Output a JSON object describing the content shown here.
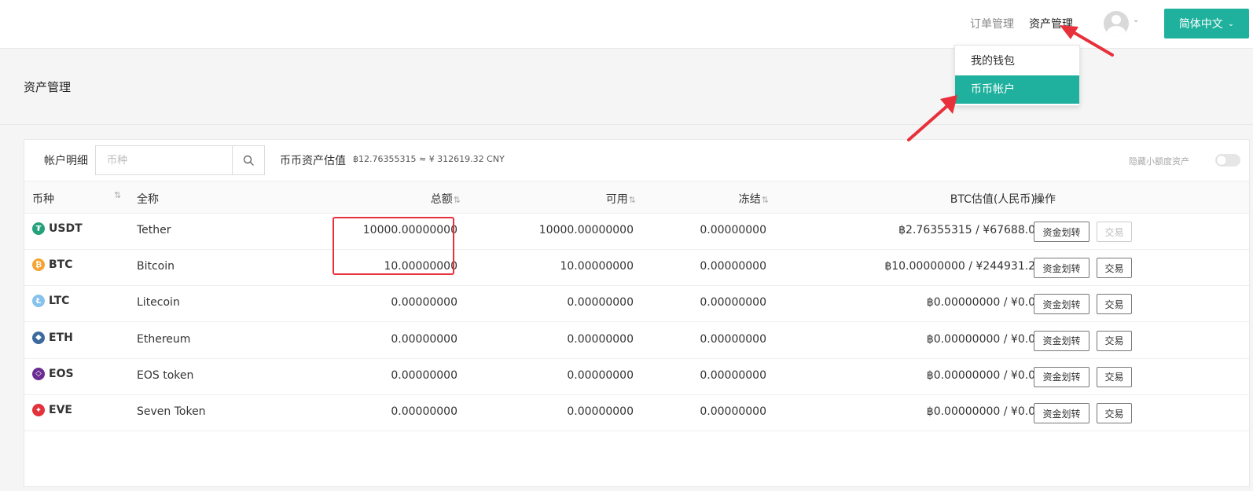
{
  "nav": {
    "orders": "订单管理",
    "assets": "资产管理",
    "language": "简体中文"
  },
  "page": {
    "title": "资产管理"
  },
  "dropdown": {
    "items": [
      {
        "label": "我的钱包"
      },
      {
        "label": "币币帐户"
      }
    ]
  },
  "filter": {
    "label": "帐户明细",
    "placeholder": "币种",
    "valuation_label": "币币资产估值",
    "valuation_value": "฿12.76355315 ≈ ¥ 312619.32 CNY",
    "hide_small_label": "隐藏小额度资产"
  },
  "table": {
    "headers": {
      "coin": "币种",
      "name": "全称",
      "total": "总额",
      "avail": "可用",
      "frozen": "冻结",
      "btc": "BTC估值(人民币)",
      "ops": "操作"
    },
    "sort_glyph": "⇅",
    "transfer_label": "资金划转",
    "trade_label": "交易",
    "rows": [
      {
        "coin": "USDT",
        "name": "Tether",
        "total": "10000.00000000",
        "avail": "10000.00000000",
        "frozen": "0.00000000",
        "btc": "฿2.76355315 / ¥67688.05",
        "icon_color": "#26a17b",
        "icon_glyph": "₮",
        "trade_disabled": true
      },
      {
        "coin": "BTC",
        "name": "Bitcoin",
        "total": "10.00000000",
        "avail": "10.00000000",
        "frozen": "0.00000000",
        "btc": "฿10.00000000 / ¥244931.26",
        "icon_color": "#f3a433",
        "icon_glyph": "₿",
        "trade_disabled": false
      },
      {
        "coin": "LTC",
        "name": "Litecoin",
        "total": "0.00000000",
        "avail": "0.00000000",
        "frozen": "0.00000000",
        "btc": "฿0.00000000 / ¥0.00",
        "icon_color": "#86c2eb",
        "icon_glyph": "Ł",
        "trade_disabled": false
      },
      {
        "coin": "ETH",
        "name": "Ethereum",
        "total": "0.00000000",
        "avail": "0.00000000",
        "frozen": "0.00000000",
        "btc": "฿0.00000000 / ¥0.00",
        "icon_color": "#3c6a9e",
        "icon_glyph": "◆",
        "trade_disabled": false
      },
      {
        "coin": "EOS",
        "name": "EOS token",
        "total": "0.00000000",
        "avail": "0.00000000",
        "frozen": "0.00000000",
        "btc": "฿0.00000000 / ¥0.00",
        "icon_color": "#6b2c91",
        "icon_glyph": "◇",
        "trade_disabled": false
      },
      {
        "coin": "EVE",
        "name": "Seven Token",
        "total": "0.00000000",
        "avail": "0.00000000",
        "frozen": "0.00000000",
        "btc": "฿0.00000000 / ¥0.00",
        "icon_color": "#e2323a",
        "icon_glyph": "✦",
        "trade_disabled": false
      }
    ]
  },
  "colors": {
    "accent": "#1fb19e",
    "annotation": "#e8303a"
  }
}
